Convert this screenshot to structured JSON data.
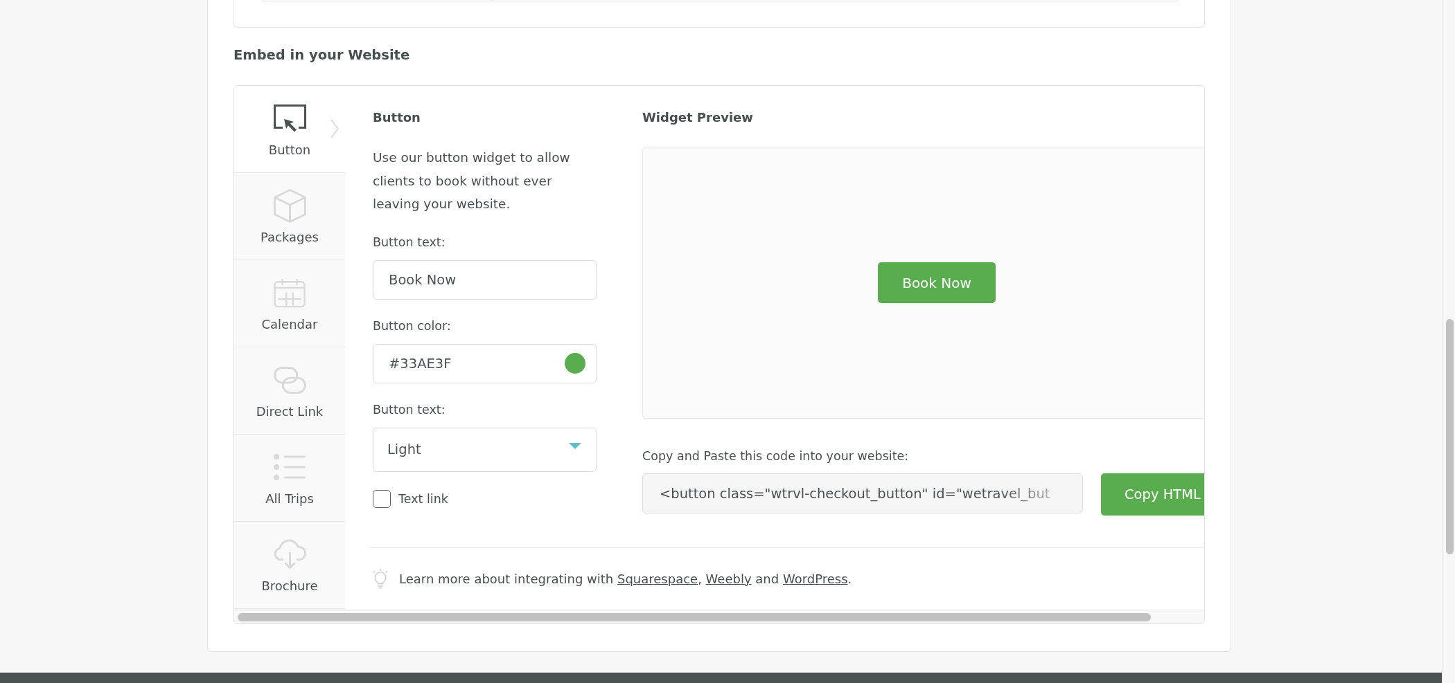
{
  "heading": "Embed in your Website",
  "tabs": [
    {
      "kind": "button",
      "label": "Button",
      "selected": true
    },
    {
      "kind": "packages",
      "label": "Packages",
      "selected": false
    },
    {
      "kind": "calendar",
      "label": "Calendar",
      "selected": false
    },
    {
      "kind": "link",
      "label": "Direct Link",
      "selected": false
    },
    {
      "kind": "trips",
      "label": "All Trips",
      "selected": false
    },
    {
      "kind": "brochure",
      "label": "Brochure",
      "selected": false
    }
  ],
  "panel": {
    "title": "Button",
    "description": "Use our button widget to allow clients to book without ever leaving your website.",
    "fields": [
      {
        "kind": "text",
        "label": "Button text:",
        "value": "Book Now"
      },
      {
        "kind": "color",
        "label": "Button color:",
        "value": "#33AE3F",
        "color": "#5aad4f"
      },
      {
        "kind": "select",
        "label": "Button text:",
        "value": "Light"
      }
    ],
    "checkbox": {
      "label": "Text link",
      "checked": false
    }
  },
  "preview": {
    "title": "Widget Preview",
    "button": "Book Now"
  },
  "code": {
    "label": "Copy and Paste this code into your website:",
    "value": "<button class=\"wtrvl-checkout_button\" id=\"wetravel_but",
    "button": "Copy HTML"
  },
  "hint": [
    {
      "kind": "text",
      "text": "Learn more about integrating with "
    },
    {
      "kind": "link",
      "text": "Squarespace"
    },
    {
      "kind": "text",
      "text": ", "
    },
    {
      "kind": "link",
      "text": "Weebly"
    },
    {
      "kind": "text",
      "text": " and "
    },
    {
      "kind": "link",
      "text": "WordPress"
    },
    {
      "kind": "text",
      "text": "."
    }
  ]
}
